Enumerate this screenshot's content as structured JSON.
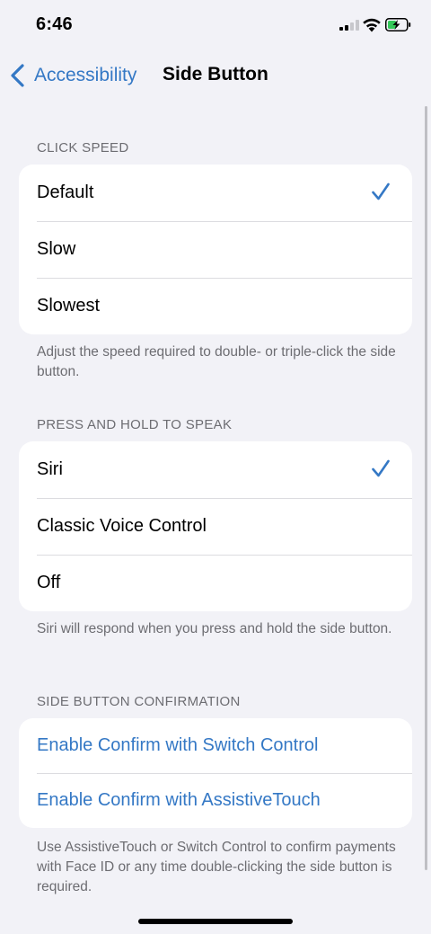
{
  "status_bar": {
    "time": "6:46"
  },
  "nav": {
    "back_label": "Accessibility",
    "title": "Side Button"
  },
  "click_speed": {
    "header": "CLICK SPEED",
    "options": [
      {
        "label": "Default",
        "selected": true
      },
      {
        "label": "Slow",
        "selected": false
      },
      {
        "label": "Slowest",
        "selected": false
      }
    ],
    "footer": "Adjust the speed required to double- or triple-click the side button."
  },
  "press_hold": {
    "header": "PRESS AND HOLD TO SPEAK",
    "options": [
      {
        "label": "Siri",
        "selected": true
      },
      {
        "label": "Classic Voice Control",
        "selected": false
      },
      {
        "label": "Off",
        "selected": false
      }
    ],
    "footer": "Siri will respond when you press and hold the side button."
  },
  "confirmation": {
    "header": "SIDE BUTTON CONFIRMATION",
    "links": [
      {
        "label": "Enable Confirm with Switch Control"
      },
      {
        "label": "Enable Confirm with AssistiveTouch"
      }
    ],
    "footer": "Use AssistiveTouch or Switch Control to confirm payments with Face ID or any time double-clicking the side button is required."
  },
  "colors": {
    "accent": "#3478c5",
    "background": "#f2f2f7",
    "secondary_text": "#6d6d72"
  },
  "icons": [
    "signal-icon",
    "wifi-icon",
    "battery-charging-icon",
    "chevron-left-icon",
    "checkmark-icon"
  ]
}
